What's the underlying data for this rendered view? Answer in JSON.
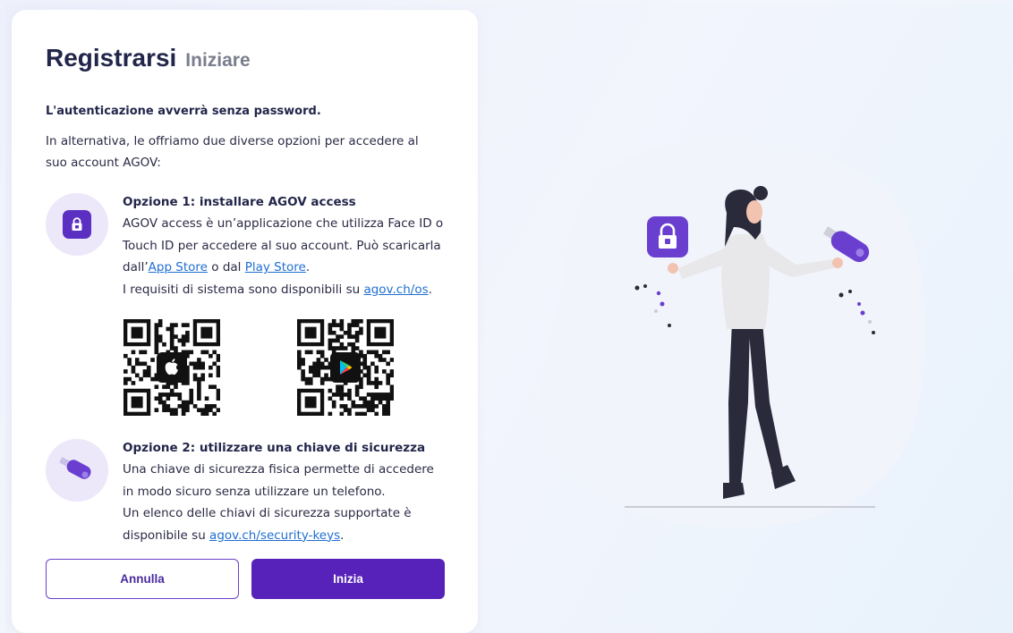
{
  "header": {
    "title": "Registrarsi",
    "subtitle": "Iniziare"
  },
  "intro": {
    "bold": "L'autenticazione avverrà senza password.",
    "text": "In alternativa, le offriamo due diverse opzioni per accedere al suo account AGOV:"
  },
  "option1": {
    "title": "Opzione 1: installare AGOV access",
    "line1": "AGOV access è un’applicazione che utilizza Face ID o",
    "line2": "Touch ID per accedere al suo account. Può scaricarla",
    "line3_pre": "dall’",
    "app_store_link": "App Store",
    "line3_mid": " o dal ",
    "play_store_link": "Play Store",
    "line3_post": ".",
    "line4_pre": "I requisiti di sistema sono disponibili su ",
    "os_link": "agov.ch/os",
    "line4_post": "."
  },
  "option2": {
    "title": "Opzione 2: utilizzare una chiave di sicurezza",
    "line1": "Una chiave di sicurezza fisica permette di accedere",
    "line2": "in modo sicuro senza utilizzare un telefono.",
    "line3": "Un elenco delle chiavi di sicurezza supportate è",
    "line4_pre": "disponibile su ",
    "keys_link": "agov.ch/security-keys",
    "line4_post": "."
  },
  "buttons": {
    "cancel": "Annulla",
    "start": "Inizia"
  },
  "icons": {
    "option1": "lock-icon",
    "option2": "security-key-icon",
    "qr1_badge": "apple-icon",
    "qr2_badge": "play-store-icon"
  },
  "colors": {
    "primary": "#5622b9",
    "link": "#1f6fd1",
    "icon_bg": "#ece8fa",
    "title": "#22264a",
    "subtitle": "#7a7d8c"
  }
}
